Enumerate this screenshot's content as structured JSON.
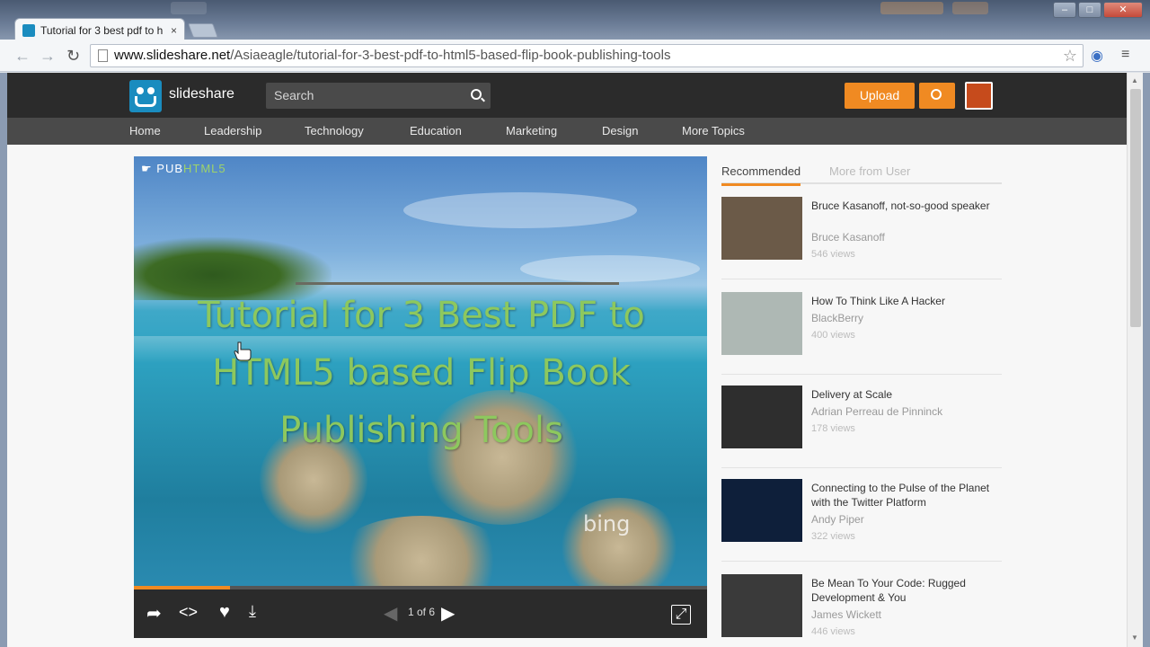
{
  "browser": {
    "tab_title": "Tutorial for 3 best pdf to h",
    "tab_close": "×",
    "url_host": "www.slideshare.net",
    "url_path": "/Asiaeagle/tutorial-for-3-best-pdf-to-html5-based-flip-book-publishing-tools",
    "back": "←",
    "forward": "→",
    "reload": "↻",
    "star": "☆",
    "menu": "≡"
  },
  "header": {
    "logo_text": "slideshare",
    "search_placeholder": "Search",
    "upload_label": "Upload"
  },
  "nav": {
    "items": [
      "Home",
      "Leadership",
      "Technology",
      "Education",
      "Marketing",
      "Design",
      "More Topics"
    ]
  },
  "slide": {
    "brand_prefix": "PUB",
    "brand_suffix": "HTML5",
    "title": "Tutorial for 3 Best PDF to HTML5 based Flip Book Publishing Tools",
    "watermark": "bing",
    "progress": 0.167
  },
  "player": {
    "page_indicator": "1 of 6"
  },
  "sidebar": {
    "tab_recommended": "Recommended",
    "tab_more": "More from User",
    "items": [
      {
        "title": "Bruce Kasanoff, not-so-good speaker",
        "author": "Bruce Kasanoff",
        "views": "546 views",
        "thumb_color": "#6b5a48"
      },
      {
        "title": "How To Think Like A Hacker",
        "author": "BlackBerry",
        "views": "400 views",
        "thumb_color": "#aeb8b4"
      },
      {
        "title": "Delivery at Scale",
        "author": "Adrian Perreau de Pinninck",
        "views": "178 views",
        "thumb_color": "#2e2e2e"
      },
      {
        "title": "Connecting to the Pulse of the Planet with the Twitter Platform",
        "author": "Andy Piper",
        "views": "322 views",
        "thumb_color": "#0e1f3a"
      },
      {
        "title": "Be Mean To Your Code: Rugged Development & You",
        "author": "James Wickett",
        "views": "446 views",
        "thumb_color": "#3a3a3a"
      }
    ]
  },
  "colors": {
    "accent": "#f08a22",
    "header_bg": "#2b2b2b",
    "nav_bg": "#4a4a4a",
    "slide_title": "#8dc85e"
  }
}
